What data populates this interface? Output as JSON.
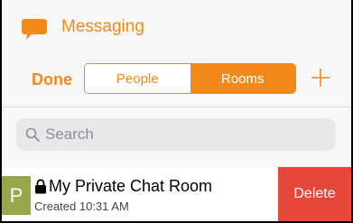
{
  "app": {
    "title": "Messaging",
    "accent": "#f28a1b"
  },
  "toolbar": {
    "done_label": "Done",
    "segments": [
      {
        "label": "People",
        "selected": false
      },
      {
        "label": "Rooms",
        "selected": true
      }
    ],
    "add_icon": "plus-icon"
  },
  "search": {
    "placeholder": "Search"
  },
  "rooms": [
    {
      "avatar_letter": "P",
      "title": "My Private Chat Room",
      "subtitle": "Created 10:31 AM",
      "locked": true,
      "delete_label": "Delete",
      "delete_color": "#e5473b"
    }
  ]
}
